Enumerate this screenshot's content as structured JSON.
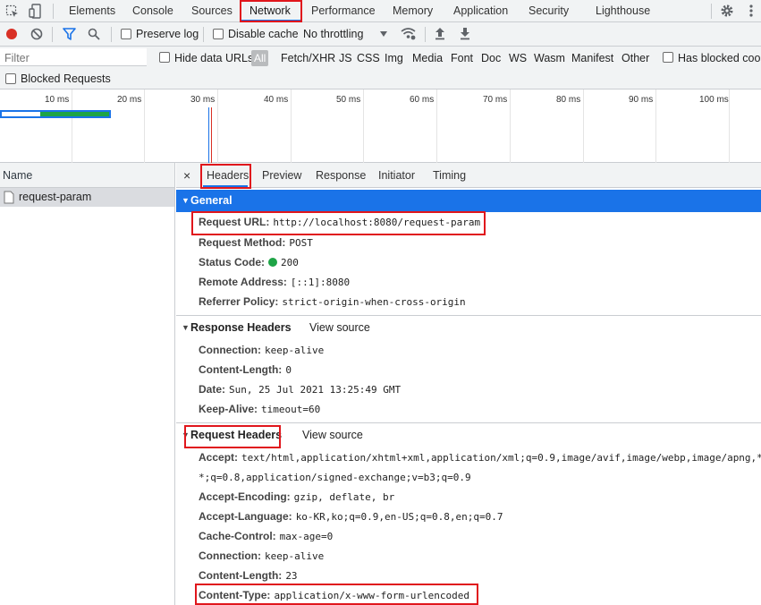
{
  "topbar": {
    "tabs": [
      "Elements",
      "Console",
      "Sources",
      "Network",
      "Performance",
      "Memory",
      "Application",
      "Security",
      "Lighthouse"
    ],
    "active_tab": "Network"
  },
  "toolbar": {
    "preserve_log": "Preserve log",
    "disable_cache": "Disable cache",
    "throttling": "No throttling"
  },
  "filterbar": {
    "placeholder": "Filter",
    "hide_data_urls": "Hide data URLs",
    "types": [
      "All",
      "Fetch/XHR",
      "JS",
      "CSS",
      "Img",
      "Media",
      "Font",
      "Doc",
      "WS",
      "Wasm",
      "Manifest",
      "Other"
    ],
    "has_blocked_cookies": "Has blocked cook",
    "blocked_requests": "Blocked Requests"
  },
  "timeline": {
    "ticks": [
      "10 ms",
      "20 ms",
      "30 ms",
      "40 ms",
      "50 ms",
      "60 ms",
      "70 ms",
      "80 ms",
      "90 ms",
      "100 ms"
    ]
  },
  "name_panel": {
    "header": "Name",
    "request": "request-param"
  },
  "detail": {
    "close": "×",
    "tabs": [
      "Headers",
      "Preview",
      "Response",
      "Initiator",
      "Timing"
    ],
    "general": {
      "title": "General",
      "rows": [
        {
          "k": "Request URL:",
          "v": "http://localhost:8080/request-param"
        },
        {
          "k": "Request Method:",
          "v": "POST"
        },
        {
          "k": "Status Code:",
          "v": "200"
        },
        {
          "k": "Remote Address:",
          "v": "[::1]:8080"
        },
        {
          "k": "Referrer Policy:",
          "v": "strict-origin-when-cross-origin"
        }
      ]
    },
    "response_headers": {
      "title": "Response Headers",
      "view_source": "View source",
      "rows": [
        {
          "k": "Connection:",
          "v": "keep-alive"
        },
        {
          "k": "Content-Length:",
          "v": "0"
        },
        {
          "k": "Date:",
          "v": "Sun, 25 Jul 2021 13:25:49 GMT"
        },
        {
          "k": "Keep-Alive:",
          "v": "timeout=60"
        }
      ]
    },
    "request_headers": {
      "title": "Request Headers",
      "view_source": "View source",
      "accept_k": "Accept:",
      "accept_v1": "text/html,application/xhtml+xml,application/xml;q=0.9,image/avif,image/webp,image/apng,*",
      "accept_v2": "*;q=0.8,application/signed-exchange;v=b3;q=0.9",
      "rows": [
        {
          "k": "Accept-Encoding:",
          "v": "gzip, deflate, br"
        },
        {
          "k": "Accept-Language:",
          "v": "ko-KR,ko;q=0.9,en-US;q=0.8,en;q=0.7"
        },
        {
          "k": "Cache-Control:",
          "v": "max-age=0"
        },
        {
          "k": "Connection:",
          "v": "keep-alive"
        },
        {
          "k": "Content-Length:",
          "v": "23"
        },
        {
          "k": "Content-Type:",
          "v": "application/x-www-form-urlencoded"
        }
      ]
    }
  },
  "colors": {
    "accent": "#1a73e8",
    "highlight": "#e0161c",
    "status_ok": "#1ea446"
  }
}
